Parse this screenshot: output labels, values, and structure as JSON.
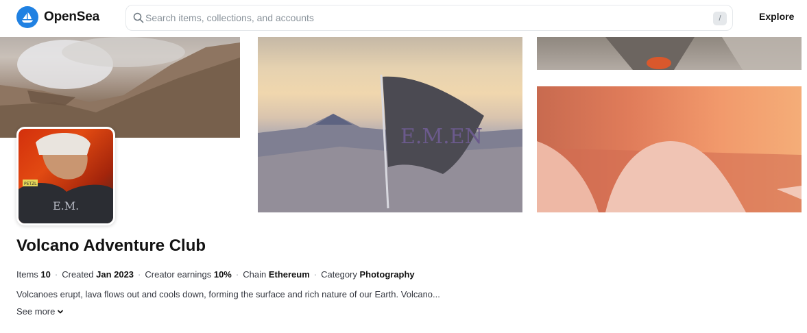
{
  "header": {
    "brand": "OpenSea",
    "search_placeholder": "Search items, collections, and accounts",
    "search_value": "",
    "shortcut_key": "/",
    "nav_explore": "Explore",
    "brand_color": "#2081e2"
  },
  "collection": {
    "title": "Volcano Adventure Club",
    "stats": [
      {
        "label": "Items",
        "value": "10"
      },
      {
        "label": "Created",
        "value": "Jan 2023"
      },
      {
        "label": "Creator earnings",
        "value": "10%"
      },
      {
        "label": "Chain",
        "value": "Ethereum"
      },
      {
        "label": "Category",
        "value": "Photography"
      }
    ],
    "stat_separator": "·",
    "description": "Volcanoes erupt, lava flows out and cools down, forming the surface and rich nature of our Earth. Volcano...",
    "see_more": "See more"
  },
  "banner": {
    "flag_text": "E.M.EN"
  },
  "avatar": {
    "shirt_text": "E.M.",
    "tag_text": "PETZL"
  }
}
